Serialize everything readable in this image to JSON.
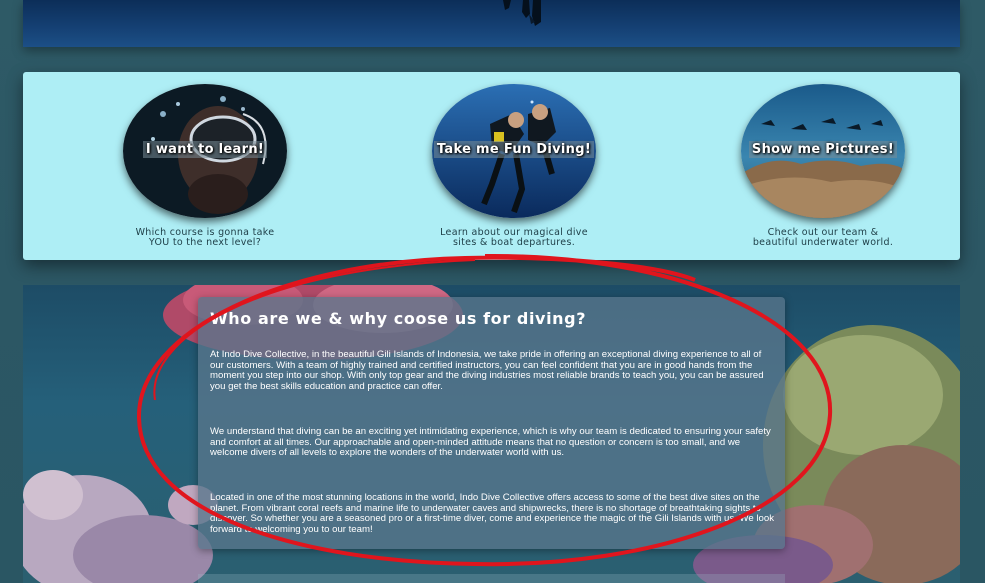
{
  "cards": [
    {
      "title": "I want to learn!",
      "description_line1": "Which course is gonna take",
      "description_line2": "YOU to the next level?"
    },
    {
      "title": "Take me Fun Diving!",
      "description_line1": "Learn about our magical dive",
      "description_line2": "sites & boat departures."
    },
    {
      "title": "Show me Pictures!",
      "description_line1": "Check out our team &",
      "description_line2": "beautiful underwater world."
    }
  ],
  "about": {
    "title": "Who are we & why coose us for diving?",
    "paragraphs": [
      "At Indo Dive Collective, in the beautiful Gili Islands of Indonesia, we take pride in offering an exceptional diving experience to all of our customers. With a team of highly trained and certified instructors, you can feel confident that you are in good hands from the moment you step into our shop. With only top gear and the diving industries most reliable brands to teach you, you can be assured you get the best skills education and practice can offer.",
      "We understand that diving can be an exciting yet intimidating experience, which is why our team is dedicated to ensuring your safety and comfort at all times. Our approachable and open-minded attitude means that no question or concern is too small, and we welcome divers of all levels to explore the wonders of the underwater world with us.",
      "Located in one of the most stunning locations in the world, Indo Dive Collective offers access to some of the best dive sites on the planet. From vibrant coral reefs and marine life to underwater caves and shipwrecks, there is no shortage of breathtaking sights to discover. So whether you are a seasoned pro or a first-time diver, come and experience the magic of the Gili Islands with us. We look forward to welcoming you to our team!"
    ]
  },
  "colors": {
    "panel": "#aeeef5",
    "annotation": "#e0151d",
    "page_bg": "#2e5a66"
  }
}
